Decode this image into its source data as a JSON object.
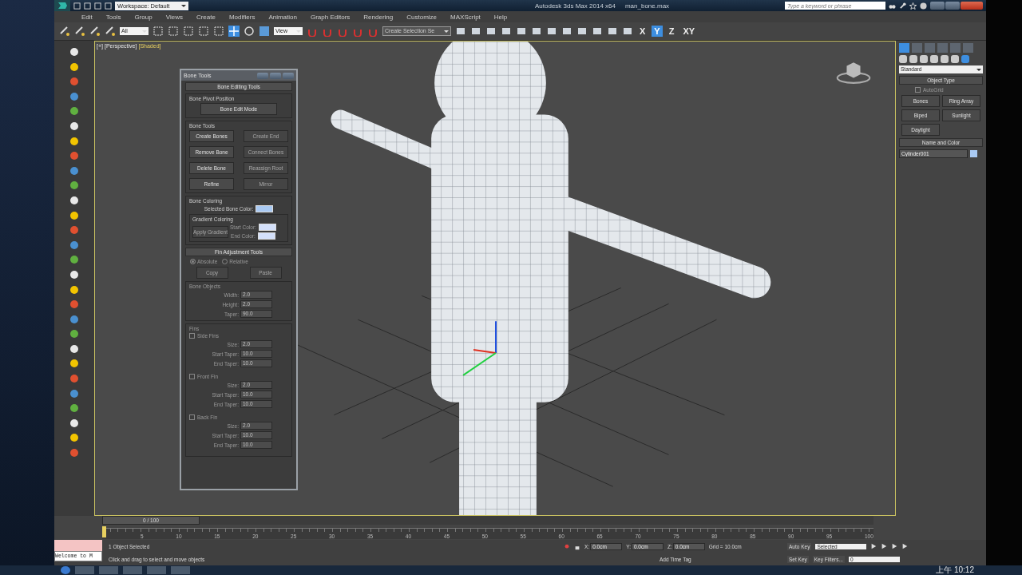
{
  "title_bar": {
    "workspace": "Workspace: Default",
    "app_title": "Autodesk 3ds Max  2014 x64",
    "file_name": "man_bone.max",
    "search_placeholder": "Type a keyword or phrase"
  },
  "menu": [
    "Edit",
    "Tools",
    "Group",
    "Views",
    "Create",
    "Modifiers",
    "Animation",
    "Graph Editors",
    "Rendering",
    "Customize",
    "MAXScript",
    "Help"
  ],
  "toolbar": {
    "selection_filter": "All",
    "reference_coordinate_system": "View",
    "named_selection_set": "Create Selection Se",
    "axis_constraints": [
      {
        "label": "X",
        "selected": false
      },
      {
        "label": "Y",
        "selected": true
      },
      {
        "label": "Z",
        "selected": false
      },
      {
        "label": "XY",
        "selected": false
      }
    ]
  },
  "viewport": {
    "labels": [
      "[+]",
      "[Perspective]",
      "[Shaded]"
    ]
  },
  "bone_tools": {
    "title": "Bone Tools",
    "editing_rollout": {
      "title": "Bone Editing Tools",
      "pivot_group": "Bone Pivot Position",
      "edit_mode_button": "Bone Edit Mode",
      "tools_group": "Bone Tools",
      "buttons": [
        {
          "label": "Create Bones",
          "disabled": false
        },
        {
          "label": "Create End",
          "disabled": true
        },
        {
          "label": "Remove Bone",
          "disabled": false
        },
        {
          "label": "Connect Bones",
          "disabled": true
        },
        {
          "label": "Delete Bone",
          "disabled": false
        },
        {
          "label": "Reassign Root",
          "disabled": true
        },
        {
          "label": "Refine",
          "disabled": false
        },
        {
          "label": "Mirror",
          "disabled": true
        }
      ],
      "coloring_group": "Bone Coloring",
      "selected_color_label": "Selected Bone Color:",
      "gradient_group": "Gradient Coloring",
      "apply_gradient": {
        "label": "Apply Gradient",
        "disabled": true
      },
      "start_color_label": "Start Color:",
      "end_color_label": "End Color:"
    },
    "fin_rollout": {
      "title": "Fin Adjustment Tools",
      "modes": [
        {
          "label": "Absolute",
          "selected": true
        },
        {
          "label": "Relative",
          "selected": false
        }
      ],
      "copy": {
        "label": "Copy",
        "disabled": true
      },
      "paste": {
        "label": "Paste",
        "disabled": true
      },
      "objects_group": "Bone Objects",
      "objects_disabled": true,
      "object_fields": [
        {
          "label": "Width:",
          "value": "2.0"
        },
        {
          "label": "Height:",
          "value": "2.0"
        },
        {
          "label": "Taper:",
          "value": "90.0"
        }
      ],
      "fins_group": "Fins",
      "fins": [
        {
          "label": "Side Fins",
          "checked": false,
          "fields": [
            {
              "label": "Size:",
              "value": "2.0"
            },
            {
              "label": "Start Taper:",
              "value": "10.0"
            },
            {
              "label": "End Taper:",
              "value": "10.0"
            }
          ]
        },
        {
          "label": "Front Fin",
          "checked": false,
          "fields": [
            {
              "label": "Size:",
              "value": "2.0"
            },
            {
              "label": "Start Taper:",
              "value": "10.0"
            },
            {
              "label": "End Taper:",
              "value": "10.0"
            }
          ]
        },
        {
          "label": "Back Fin",
          "checked": false,
          "fields": [
            {
              "label": "Size:",
              "value": "2.0"
            },
            {
              "label": "Start Taper:",
              "value": "10.0"
            },
            {
              "label": "End Taper:",
              "value": "10.0"
            }
          ]
        }
      ]
    }
  },
  "command_panel": {
    "tabs": [
      {
        "selected": true
      },
      {
        "selected": false
      },
      {
        "selected": false
      },
      {
        "selected": false
      },
      {
        "selected": false
      },
      {
        "selected": false
      }
    ],
    "categories": [
      {
        "selected": false
      },
      {
        "selected": false
      },
      {
        "selected": false
      },
      {
        "selected": false
      },
      {
        "selected": false
      },
      {
        "selected": false
      },
      {
        "selected": true
      }
    ],
    "dropdown": "Standard",
    "object_type": {
      "title": "Object Type",
      "autogrid": {
        "label": "AutoGrid",
        "checked": false,
        "disabled": true
      },
      "buttons": [
        "Bones",
        "Ring Array",
        "Biped",
        "Sunlight",
        "Daylight"
      ]
    },
    "name_and_color": {
      "title": "Name and Color",
      "name": "Cylinder001",
      "color": "#a9c9f2"
    }
  },
  "timeline": {
    "frame_slider": {
      "label": "0 / 100",
      "level": 0
    },
    "ticks": [
      "5",
      "10",
      "15",
      "20",
      "25",
      "30",
      "35",
      "40",
      "45",
      "50",
      "55",
      "60",
      "65",
      "70",
      "75",
      "80",
      "85",
      "90",
      "95",
      "100"
    ]
  },
  "status_bar": {
    "maxscript_listener": "Welcome to M",
    "selection": "1 Object Selected",
    "prompt": "Click and drag to select and move objects",
    "coordinates": [
      {
        "label": "X:",
        "value": "0.0cm"
      },
      {
        "label": "Y:",
        "value": "0.0cm"
      },
      {
        "label": "Z:",
        "value": "0.0cm"
      }
    ],
    "grid": "Grid = 10.0cm",
    "add_time_tag": "Add Time Tag",
    "auto_key": "Auto Key",
    "key_mode": "Selected",
    "set_key": "Set Key",
    "key_filters": "Key Filters...",
    "current_frame": "0"
  },
  "taskbar": {
    "clock": "上午 10:12"
  }
}
